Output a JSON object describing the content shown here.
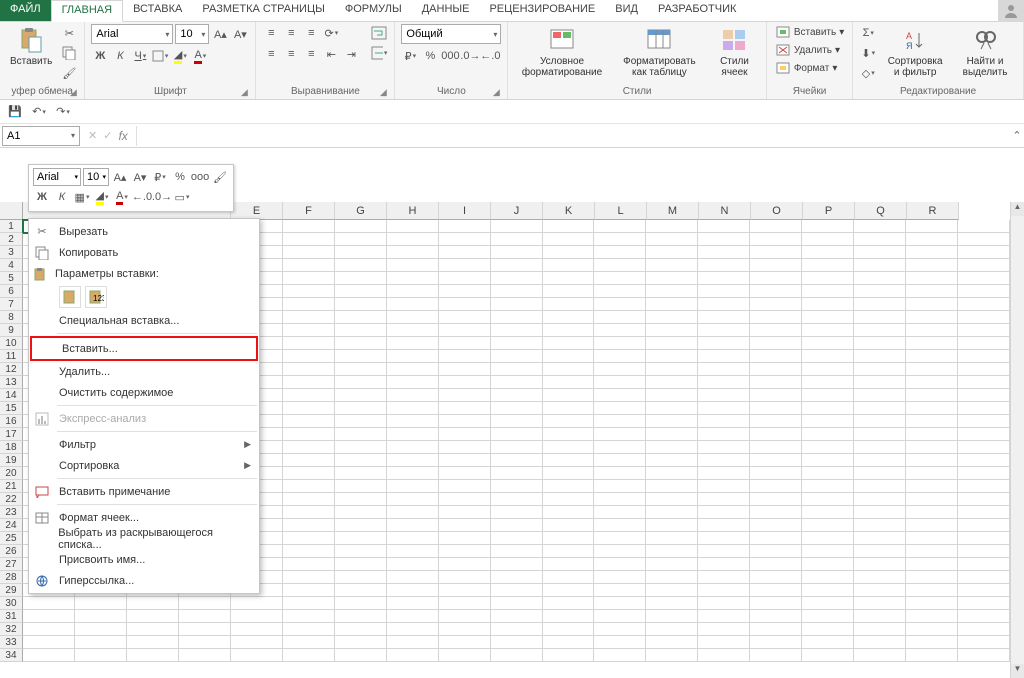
{
  "tabs": {
    "file": "ФАЙЛ",
    "items": [
      "ГЛАВНАЯ",
      "ВСТАВКА",
      "РАЗМЕТКА СТРАНИЦЫ",
      "ФОРМУЛЫ",
      "ДАННЫЕ",
      "РЕЦЕНЗИРОВАНИЕ",
      "ВИД",
      "РАЗРАБОТЧИК"
    ],
    "active": 0
  },
  "ribbon": {
    "clipboard": {
      "label": "уфер обмена",
      "paste": "Вставить"
    },
    "font": {
      "label": "Шрифт",
      "name": "Arial",
      "size": "10",
      "bold": "Ж",
      "italic": "К",
      "underline": "Ч"
    },
    "align": {
      "label": "Выравнивание"
    },
    "number": {
      "label": "Число",
      "format": "Общий"
    },
    "styles": {
      "label": "Стили",
      "cond": "Условное форматирование",
      "table": "Форматировать как таблицу",
      "cell": "Стили ячеек"
    },
    "cells": {
      "label": "Ячейки",
      "insert": "Вставить",
      "delete": "Удалить",
      "format": "Формат"
    },
    "editing": {
      "label": "Редактирование",
      "sort": "Сортировка и фильтр",
      "find": "Найти и выделить"
    }
  },
  "namebox": "A1",
  "mini": {
    "font": "Arial",
    "size": "10",
    "bold": "Ж",
    "italic": "К"
  },
  "columns": [
    "E",
    "F",
    "G",
    "H",
    "I",
    "J",
    "K",
    "L",
    "M",
    "N",
    "O",
    "P",
    "Q",
    "R"
  ],
  "rows": [
    1,
    2,
    3,
    4,
    5,
    6,
    7,
    8,
    9,
    10,
    11,
    12,
    13,
    14,
    15,
    16,
    17,
    18,
    19,
    20,
    21,
    22,
    23,
    24,
    25,
    26,
    27,
    28,
    29,
    30,
    31,
    32,
    33,
    34
  ],
  "ctx": {
    "cut": "Вырезать",
    "copy": "Копировать",
    "paste_header": "Параметры вставки:",
    "paste_special": "Специальная вставка...",
    "insert": "Вставить...",
    "delete": "Удалить...",
    "clear": "Очистить содержимое",
    "quick": "Экспресс-анализ",
    "filter": "Фильтр",
    "sort": "Сортировка",
    "comment": "Вставить примечание",
    "format": "Формат ячеек...",
    "dropdown": "Выбрать из раскрывающегося списка...",
    "name": "Присвоить имя...",
    "hyperlink": "Гиперссылка..."
  }
}
